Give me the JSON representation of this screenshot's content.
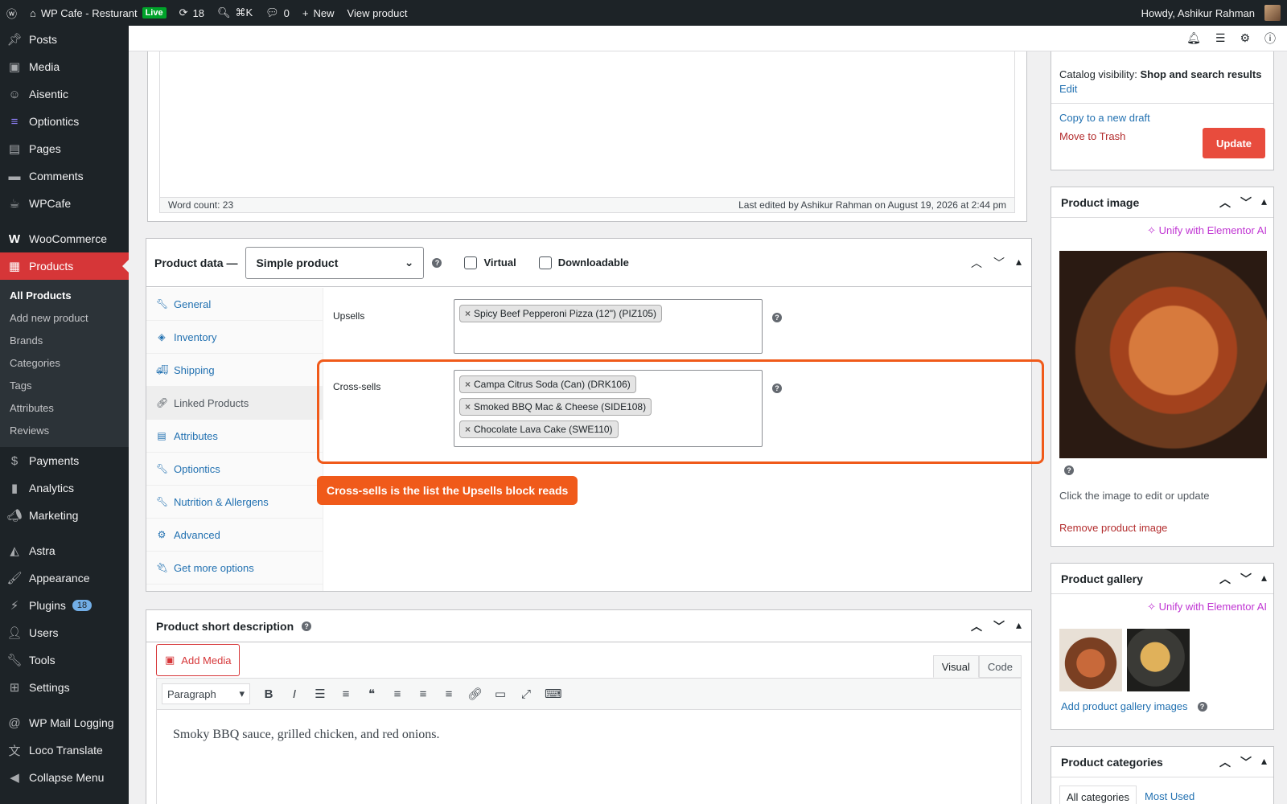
{
  "adminbar": {
    "site_name": "WP Cafe - Resturant",
    "live_badge": "Live",
    "updates_count": "18",
    "search_shortcut": "⌘K",
    "comments_count": "0",
    "new_label": "New",
    "view_product": "View product",
    "howdy": "Howdy, Ashikur Rahman"
  },
  "sidebar": {
    "items_top": [
      {
        "label": "Posts",
        "icon": "pin-icon"
      },
      {
        "label": "Media",
        "icon": "media-icon"
      },
      {
        "label": "Aisentic",
        "icon": "robot-icon"
      },
      {
        "label": "Optiontics",
        "icon": "layers-icon"
      },
      {
        "label": "Pages",
        "icon": "page-icon"
      },
      {
        "label": "Comments",
        "icon": "comment-icon"
      },
      {
        "label": "WPCafe",
        "icon": "cafe-icon"
      }
    ],
    "woocommerce": "WooCommerce",
    "products": "Products",
    "products_sub": [
      "All Products",
      "Add new product",
      "Brands",
      "Categories",
      "Tags",
      "Attributes",
      "Reviews"
    ],
    "items_mid": [
      {
        "label": "Payments",
        "icon": "payments-icon"
      },
      {
        "label": "Analytics",
        "icon": "analytics-icon"
      },
      {
        "label": "Marketing",
        "icon": "megaphone-icon"
      }
    ],
    "items_low": [
      {
        "label": "Astra",
        "icon": "astra-icon"
      },
      {
        "label": "Appearance",
        "icon": "brush-icon"
      },
      {
        "label": "Plugins",
        "icon": "plugin-icon",
        "badge": "18"
      },
      {
        "label": "Users",
        "icon": "user-icon"
      },
      {
        "label": "Tools",
        "icon": "wrench-icon"
      },
      {
        "label": "Settings",
        "icon": "settings-icon"
      }
    ],
    "items_bottom": [
      {
        "label": "WP Mail Logging",
        "icon": "at-icon"
      },
      {
        "label": "Loco Translate",
        "icon": "translate-icon"
      },
      {
        "label": "Collapse Menu",
        "icon": "collapse-icon"
      }
    ]
  },
  "editor": {
    "word_count": "Word count: 23",
    "last_edited": "Last edited by Ashikur Rahman on August 19, 2026 at 2:44 pm"
  },
  "product_data": {
    "title": "Product data —",
    "type_value": "Simple product",
    "virtual": "Virtual",
    "downloadable": "Downloadable",
    "tabs": [
      {
        "label": "General",
        "icon": "wrench-icon"
      },
      {
        "label": "Inventory",
        "icon": "tag-icon"
      },
      {
        "label": "Shipping",
        "icon": "truck-icon"
      },
      {
        "label": "Linked Products",
        "icon": "link-icon"
      },
      {
        "label": "Attributes",
        "icon": "list-icon"
      },
      {
        "label": "Optiontics",
        "icon": "wrench-icon"
      },
      {
        "label": "Nutrition & Allergens",
        "icon": "wrench-icon"
      },
      {
        "label": "Advanced",
        "icon": "gear-icon"
      },
      {
        "label": "Get more options",
        "icon": "plugin-icon"
      }
    ],
    "upsells_label": "Upsells",
    "upsells": [
      "Spicy Beef Pepperoni Pizza (12\") (PIZ105)"
    ],
    "crosssells_label": "Cross-sells",
    "crosssells": [
      "Campa Citrus Soda (Can) (DRK106)",
      "Smoked BBQ Mac & Cheese (SIDE108)",
      "Chocolate Lava Cake (SWE110)"
    ]
  },
  "callout": "Cross-sells is the list the Upsells block reads",
  "short_desc": {
    "title": "Product short description",
    "add_media": "Add Media",
    "tab_visual": "Visual",
    "tab_code": "Code",
    "paragraph": "Paragraph",
    "content": "Smoky BBQ sauce, grilled chicken, and red onions."
  },
  "publish": {
    "catalog_label": "Catalog visibility:",
    "catalog_value": "Shop and search results",
    "edit": "Edit",
    "copy_draft": "Copy to a new draft",
    "trash": "Move to Trash",
    "update": "Update"
  },
  "product_image": {
    "title": "Product image",
    "elementor": "Unify with Elementor AI",
    "hint": "Click the image to edit or update",
    "remove": "Remove product image"
  },
  "gallery": {
    "title": "Product gallery",
    "elementor": "Unify with Elementor AI",
    "add": "Add product gallery images"
  },
  "categories": {
    "title": "Product categories",
    "tab_all": "All categories",
    "tab_most": "Most Used"
  },
  "colors": {
    "accent": "#d63638",
    "highlight": "#f05a1a",
    "link": "#2271b1",
    "elementor": "#c036d3"
  }
}
